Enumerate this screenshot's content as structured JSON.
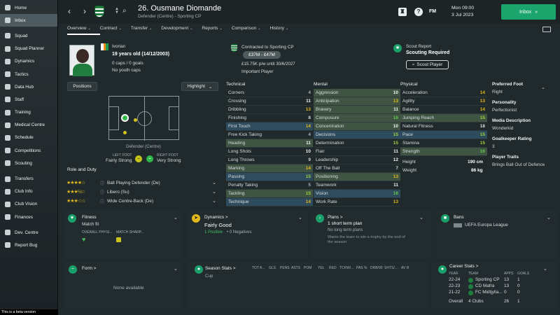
{
  "sidebar": {
    "items": [
      {
        "label": "Home",
        "icon": "home-icon"
      },
      {
        "label": "Inbox",
        "icon": "inbox-icon",
        "active": true
      },
      {
        "label": "Squad",
        "icon": "squad-icon"
      },
      {
        "label": "Squad Planner",
        "icon": "squad-planner-icon"
      },
      {
        "label": "Dynamics",
        "icon": "dynamics-icon"
      },
      {
        "label": "Tactics",
        "icon": "tactics-icon"
      },
      {
        "label": "Data Hub",
        "icon": "data-hub-icon"
      },
      {
        "label": "Staff",
        "icon": "staff-icon"
      },
      {
        "label": "Training",
        "icon": "training-icon"
      },
      {
        "label": "Medical Centre",
        "icon": "medical-centre-icon"
      },
      {
        "label": "Schedule",
        "icon": "schedule-icon"
      },
      {
        "label": "Competitions",
        "icon": "competitions-icon"
      },
      {
        "label": "Scouting",
        "icon": "scouting-icon"
      },
      {
        "label": "Transfers",
        "icon": "transfers-icon"
      },
      {
        "label": "Club Info",
        "icon": "club-info-icon"
      },
      {
        "label": "Club Vision",
        "icon": "club-vision-icon"
      },
      {
        "label": "Finances",
        "icon": "finances-icon"
      },
      {
        "label": "Dev. Centre",
        "icon": "dev-centre-icon"
      },
      {
        "label": "Report Bug",
        "icon": "report-bug-icon"
      }
    ],
    "beta_notice": "This is a beta version"
  },
  "header": {
    "title": "26. Ousmane Diomande",
    "subtitle": "Defender (Centre) - Sporting CP",
    "fm": "FM",
    "day_time": "Mon 09:00",
    "date": "3 Jul 2023",
    "inbox_label": "Inbox",
    "inbox_arrow": "»"
  },
  "tabs": [
    "Overview",
    "Contract",
    "Transfer",
    "Development",
    "Reports",
    "Comparison",
    "History"
  ],
  "profile": {
    "nationality": "Ivorian",
    "age": "19 years old (14/12/2003)",
    "caps": "0 caps / 0 goals",
    "youth": "No youth caps",
    "contract_label": "Contracted to Sporting CP",
    "value": "£37M - £47M",
    "wage": "£15.75K p/w until 30/6/2027",
    "status": "Important Player",
    "scout_report_label": "Scout Report",
    "scout_status": "Scouting Required",
    "scout_button": "Scout Player"
  },
  "controls": {
    "positions": "Positions",
    "highlight": "Highlight",
    "highlight_chevron": "⌄"
  },
  "pitch": {
    "position_label": "Defender (Centre)",
    "left_foot_label": "LEFT FOOT",
    "left_foot_value": "Fairly Strong",
    "right_foot_label": "RIGHT FOOT",
    "right_foot_value": "Very Strong"
  },
  "roles": {
    "title": "Role and Duty",
    "items": [
      {
        "label": "Ball Playing Defender (De)",
        "stars": "★★★★☆"
      },
      {
        "label": "Libero (Su)",
        "stars": "★★★½☆"
      },
      {
        "label": "Wide Centre-Back (De)",
        "stars": "★★★☆☆"
      }
    ]
  },
  "technical": {
    "title": "Technical",
    "attrs": [
      {
        "name": "Corners",
        "value": "4",
        "hl": ""
      },
      {
        "name": "Crossing",
        "value": "11",
        "hl": ""
      },
      {
        "name": "Dribbling",
        "value": "13",
        "hl": ""
      },
      {
        "name": "Finishing",
        "value": "8",
        "hl": ""
      },
      {
        "name": "First Touch",
        "value": "14",
        "hl": "b"
      },
      {
        "name": "Free Kick Taking",
        "value": "4",
        "hl": ""
      },
      {
        "name": "Heading",
        "value": "11",
        "hl": "g"
      },
      {
        "name": "Long Shots",
        "value": "10",
        "hl": ""
      },
      {
        "name": "Long Throws",
        "value": "9",
        "hl": ""
      },
      {
        "name": "Marking",
        "value": "14",
        "hl": "g"
      },
      {
        "name": "Passing",
        "value": "15",
        "hl": "b"
      },
      {
        "name": "Penalty Taking",
        "value": "5",
        "hl": ""
      },
      {
        "name": "Tackling",
        "value": "15",
        "hl": "g"
      },
      {
        "name": "Technique",
        "value": "14",
        "hl": "b"
      }
    ]
  },
  "mental": {
    "title": "Mental",
    "attrs": [
      {
        "name": "Aggression",
        "value": "10",
        "hl": "g"
      },
      {
        "name": "Anticipation",
        "value": "13",
        "hl": "g"
      },
      {
        "name": "Bravery",
        "value": "11",
        "hl": "g"
      },
      {
        "name": "Composure",
        "value": "16",
        "hl": "g"
      },
      {
        "name": "Concentration",
        "value": "10",
        "hl": "g"
      },
      {
        "name": "Decisions",
        "value": "15",
        "hl": "b"
      },
      {
        "name": "Determination",
        "value": "15",
        "hl": ""
      },
      {
        "name": "Flair",
        "value": "11",
        "hl": ""
      },
      {
        "name": "Leadership",
        "value": "12",
        "hl": ""
      },
      {
        "name": "Off The Ball",
        "value": "7",
        "hl": ""
      },
      {
        "name": "Positioning",
        "value": "13",
        "hl": "g"
      },
      {
        "name": "Teamwork",
        "value": "11",
        "hl": ""
      },
      {
        "name": "Vision",
        "value": "16",
        "hl": "b"
      },
      {
        "name": "Work Rate",
        "value": "13",
        "hl": ""
      }
    ]
  },
  "physical": {
    "title": "Physical",
    "attrs": [
      {
        "name": "Acceleration",
        "value": "14",
        "hl": ""
      },
      {
        "name": "Agility",
        "value": "13",
        "hl": ""
      },
      {
        "name": "Balance",
        "value": "14",
        "hl": ""
      },
      {
        "name": "Jumping Reach",
        "value": "15",
        "hl": "g"
      },
      {
        "name": "Natural Fitness",
        "value": "18",
        "hl": ""
      },
      {
        "name": "Pace",
        "value": "15",
        "hl": "b"
      },
      {
        "name": "Stamina",
        "value": "15",
        "hl": ""
      },
      {
        "name": "Strength",
        "value": "16",
        "hl": "g"
      }
    ],
    "height_label": "Height",
    "height": "190 cm",
    "weight_label": "Weight",
    "weight": "86 kg"
  },
  "info": {
    "preferred_foot_label": "Preferred Foot",
    "preferred_foot": "Right",
    "personality_label": "Personality",
    "personality": "Perfectionist",
    "media_label": "Media Description",
    "media": "Wonderkid",
    "gk_label": "Goalkeeper Rating",
    "gk": "3",
    "traits_label": "Player Traits",
    "traits": "Brings Ball Out of Defence"
  },
  "cards": {
    "fitness": {
      "title": "Fitness",
      "status": "Match fit",
      "overall": "OVERALL PHYSI...",
      "sharp": "MATCH SHARP..."
    },
    "dynamics": {
      "title": "Dynamics >",
      "status": "Fairly Good",
      "positive": "1 Positive",
      "negative": "• 0 Negatives"
    },
    "plans": {
      "title": "Plans >",
      "status": "1 short term plan",
      "long": "No long term plans",
      "desc": "Wants the team to win a trophy by the end of the season"
    },
    "bans": {
      "title": "Bans",
      "comp": "UEFA Europa League"
    }
  },
  "form": {
    "title": "Form >",
    "empty": "None available"
  },
  "season": {
    "title": "Season Stats >",
    "comp": "Cup",
    "cols": [
      "TOT A...",
      "GLS",
      "PENS",
      "ASTS",
      "POM",
      "YEL",
      "RED",
      "TCKW/...",
      "PAS %",
      "DRB/90",
      "SHTS/...",
      "AV R"
    ]
  },
  "career": {
    "title": "Career Stats >",
    "cols": {
      "year": "YEAR",
      "team": "TEAM",
      "apps": "APPS",
      "goals": "GOALS"
    },
    "rows": [
      {
        "year": "22-24",
        "team": "Sporting CP",
        "apps": "13",
        "goals": "1"
      },
      {
        "year": "22-23",
        "team": "CD Mafra",
        "apps": "13",
        "goals": "0"
      },
      {
        "year": "21-22",
        "team": "FC Midtjylla...",
        "apps": "0",
        "goals": "0"
      }
    ],
    "overall": {
      "label": "Overall",
      "team": "4 Clubs",
      "apps": "26",
      "goals": "1"
    }
  }
}
